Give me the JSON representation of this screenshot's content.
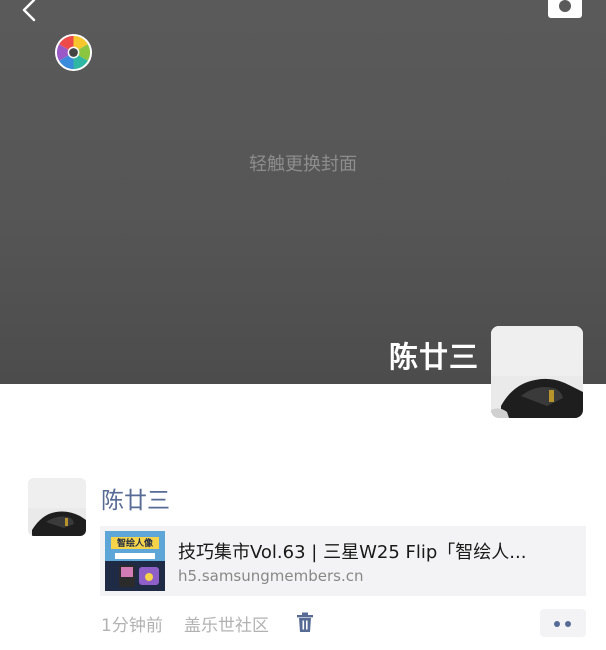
{
  "cover": {
    "hint": "轻触更换封面",
    "owner_name": "陈廿三"
  },
  "post": {
    "author": "陈廿三",
    "link": {
      "title": "技巧集市Vol.63 | 三星W25 Flip「智绘人...",
      "domain": "h5.samsungmembers.cn",
      "thumb_text": "智绘人像"
    },
    "time": "1分钟前",
    "source": "盖乐世社区"
  },
  "colors": {
    "cover_bg": "#565656",
    "name_link": "#576b95",
    "meta_text": "#b2b2b2",
    "card_bg": "#f3f3f5"
  },
  "icons": [
    "back-arrow-icon",
    "camera-icon",
    "aperture-icon",
    "trash-icon",
    "more-dots-icon"
  ]
}
